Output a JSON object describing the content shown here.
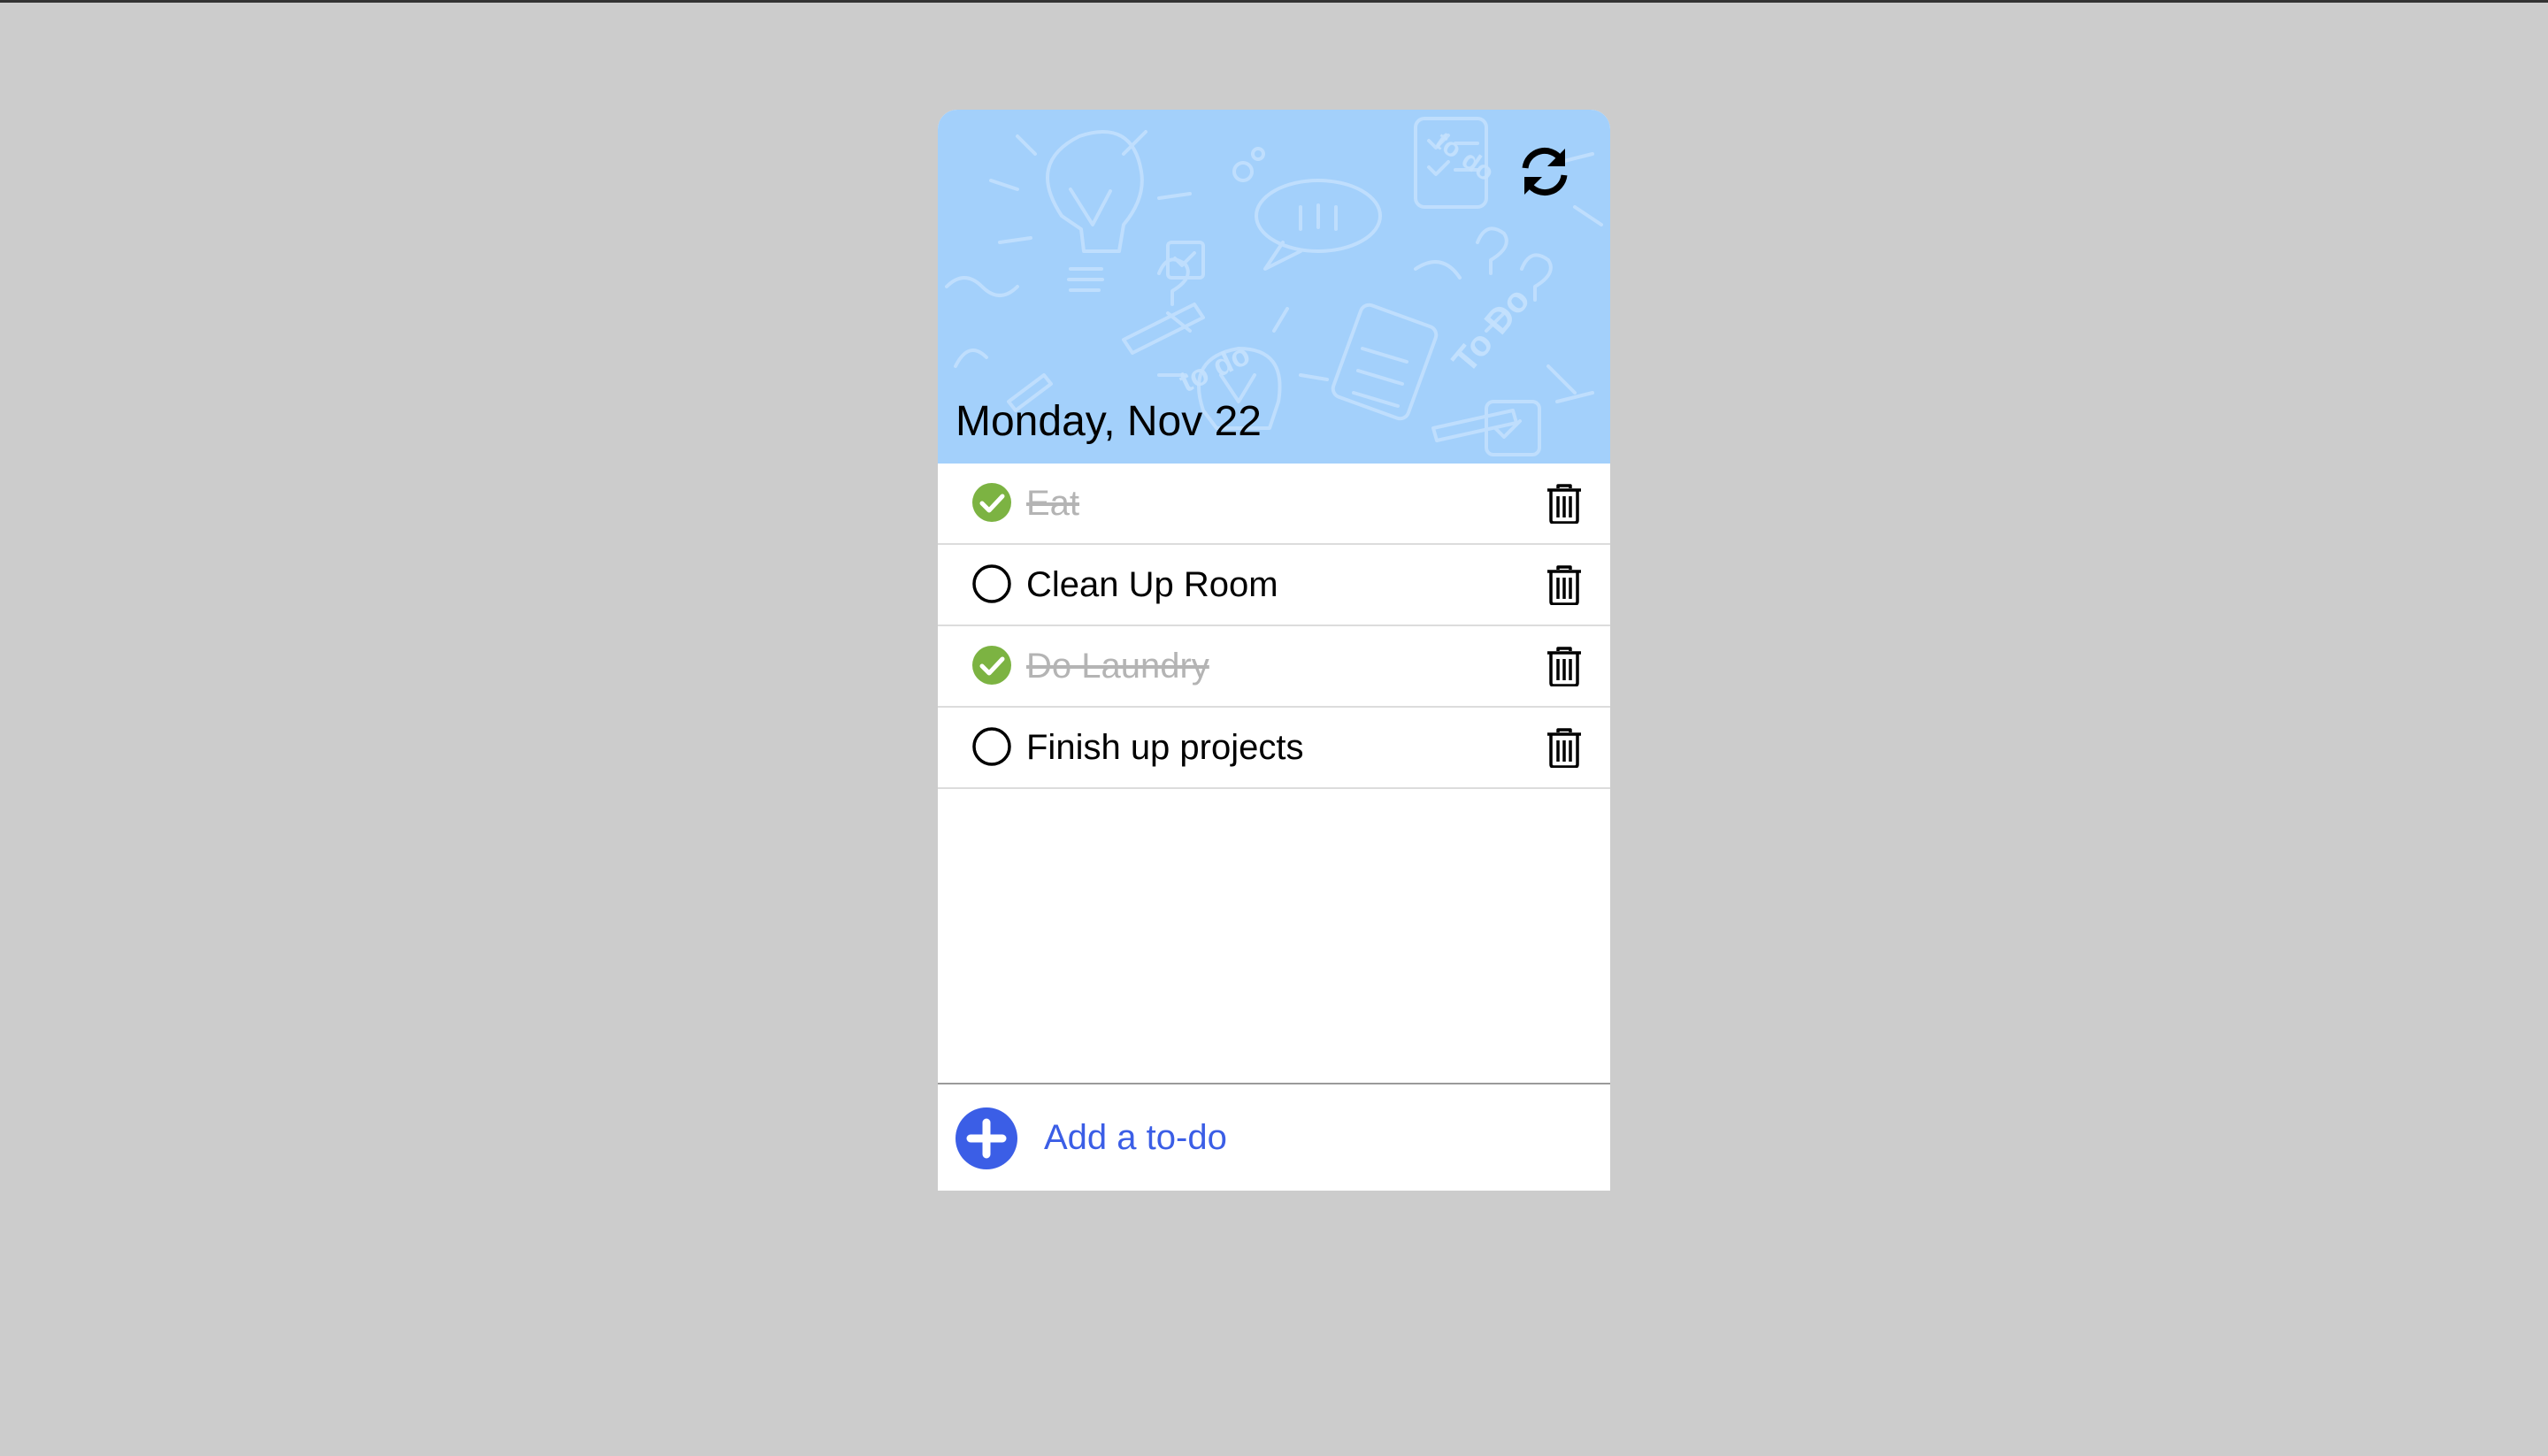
{
  "header": {
    "date": "Monday, Nov 22",
    "background_color": "#a3d0fb",
    "doodle_words": [
      "to do",
      "to do",
      "To Do",
      "to do"
    ],
    "refresh_icon": "refresh-icon"
  },
  "todos": [
    {
      "label": "Eat",
      "done": true
    },
    {
      "label": "Clean Up Room",
      "done": false
    },
    {
      "label": "Do Laundry",
      "done": true
    },
    {
      "label": "Finish up projects",
      "done": false
    }
  ],
  "footer": {
    "add_label": "Add a to-do",
    "add_icon": "plus-circle-icon"
  },
  "colors": {
    "page_background": "#cccccc",
    "check_done": "#7cb342",
    "accent_blue": "#3b5ee6",
    "done_text": "#b4b4b4"
  },
  "icons": {
    "done": "check-circle-icon",
    "pending": "empty-circle-icon",
    "delete": "trash-icon"
  }
}
